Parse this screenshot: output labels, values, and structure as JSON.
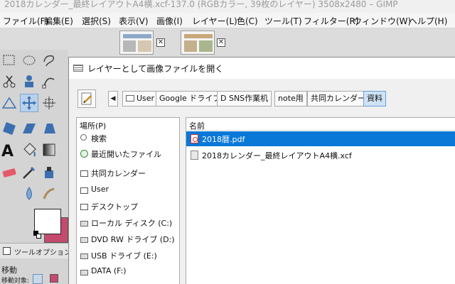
{
  "window": {
    "title": "2018カレンダー_最終レイアウトA4横.xcf-137.0 (RGBカラー, 39枚のレイヤー) 3508x2480 – GIMP"
  },
  "menubar": {
    "items": [
      "ファイル(F)",
      "編集(E)",
      "選択(S)",
      "表示(V)",
      "画像(I)",
      "レイヤー(L)",
      "色(C)",
      "ツール(T)",
      "フィルター(R)",
      "ウィンドウ(W)",
      "ヘルプ(H)"
    ]
  },
  "toolbox": {
    "tool_options_label": "ツールオプション",
    "move_label": "移動",
    "mode_label": "移動対象:",
    "fg_color": "#ffffff",
    "bg_color": "#c44a6e"
  },
  "dialog": {
    "title": "レイヤーとして画像ファイルを開く",
    "breadcrumbs": [
      "User",
      "Google ドライブ",
      "D SNS作業机",
      "note用",
      "共同カレンダー",
      "資料"
    ],
    "places_header": "場所(P)",
    "places": [
      {
        "label": "検索",
        "icon": "search-icon"
      },
      {
        "label": "最近開いたファイル",
        "icon": "recent-icon"
      },
      {
        "label": "共同カレンダー",
        "icon": "folder-icon"
      },
      {
        "label": "User",
        "icon": "folder-icon"
      },
      {
        "label": "デスクトップ",
        "icon": "folder-icon"
      },
      {
        "label": "ローカル ディスク (C:)",
        "icon": "drive-icon"
      },
      {
        "label": "DVD RW ドライブ (D:)",
        "icon": "dvd-icon"
      },
      {
        "label": "USB ドライブ (E:)",
        "icon": "drive-icon"
      },
      {
        "label": "DATA (F:)",
        "icon": "drive-icon"
      }
    ],
    "files_column": "名前",
    "files": [
      {
        "name": "2018暦.pdf",
        "selected": true,
        "icon": "pdf-icon"
      },
      {
        "name": "2018カレンダー_最終レイアウトA4横.xcf",
        "selected": false,
        "icon": "xcf-icon"
      }
    ],
    "selection_color": "#0a78d7"
  }
}
